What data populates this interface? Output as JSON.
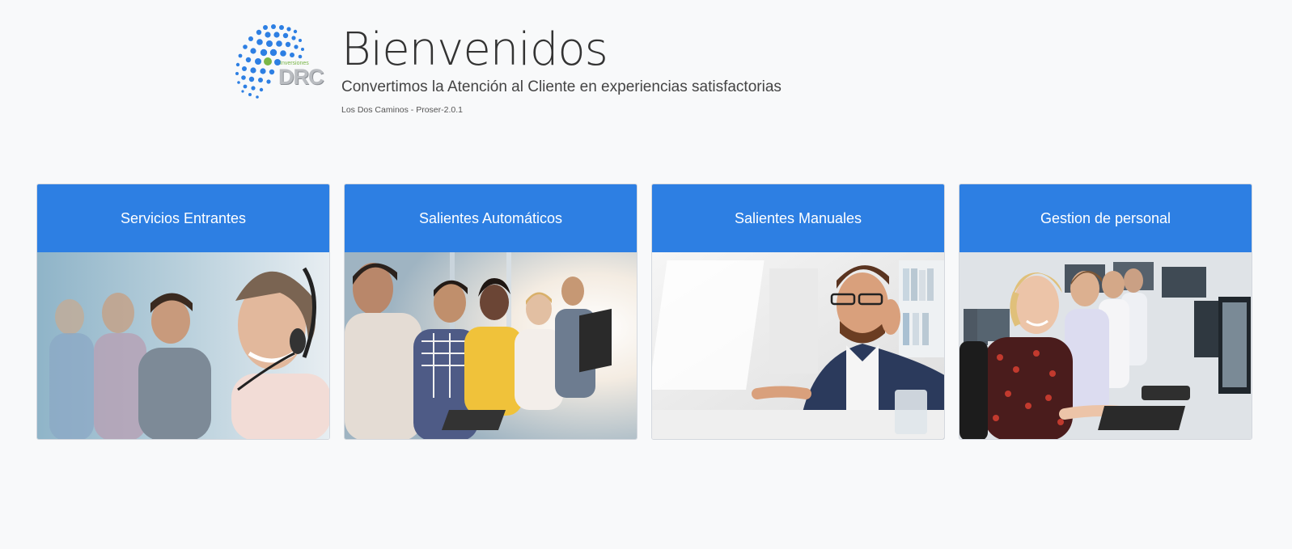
{
  "header": {
    "logo_small": "Inversiones",
    "logo_big": "DRC",
    "title": "Bienvenidos",
    "subtitle": "Convertimos la Atención al Cliente en experiencias satisfactorias",
    "version": "Los Dos Caminos - Proser-2.0.1"
  },
  "cards": [
    {
      "label": "Servicios Entrantes",
      "image": "call-center-agent-woman-headset-photo"
    },
    {
      "label": "Salientes Automáticos",
      "image": "call-center-team-row-photo"
    },
    {
      "label": "Salientes Manuales",
      "image": "call-center-agent-man-headset-photo"
    },
    {
      "label": "Gestion de personal",
      "image": "call-center-office-staff-photo"
    }
  ],
  "colors": {
    "background": "#f8f9fa",
    "card_header": "#2d7fe3",
    "logo_blue": "#2d7fe3",
    "logo_green": "#7ab648"
  }
}
